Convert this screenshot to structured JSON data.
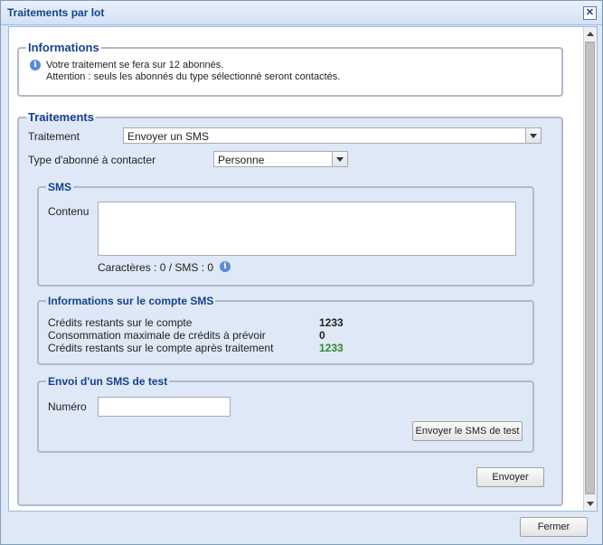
{
  "dialog": {
    "title": "Traitements par lot"
  },
  "informations": {
    "legend": "Informations",
    "line1": "Votre traitement se fera sur 12 abonnés.",
    "line2": "Attention : seuls les abonnés du type sélectionné seront contactés."
  },
  "traitements": {
    "legend": "Traitements",
    "traitement_label": "Traitement",
    "traitement_value": "Envoyer un SMS",
    "type_label": "Type d'abonné à contacter",
    "type_value": "Personne"
  },
  "sms": {
    "legend": "SMS",
    "contenu_label": "Contenu",
    "contenu_value": "",
    "counter": "Caractères : 0 / SMS : 0"
  },
  "compte": {
    "legend": "Informations sur le compte SMS",
    "rows": [
      {
        "label": "Crédits restants sur le compte",
        "value": "1233"
      },
      {
        "label": "Consommation maximale de crédits à prévoir",
        "value": "0"
      },
      {
        "label": "Crédits restants sur le compte après traitement",
        "value": "1233"
      }
    ],
    "after_color": "#2e8b2e"
  },
  "test": {
    "legend": "Envoi d'un SMS de test",
    "numero_label": "Numéro",
    "numero_value": "",
    "send_test_label": "Envoyer le SMS de test"
  },
  "actions": {
    "envoyer_label": "Envoyer",
    "fermer_label": "Fermer"
  }
}
